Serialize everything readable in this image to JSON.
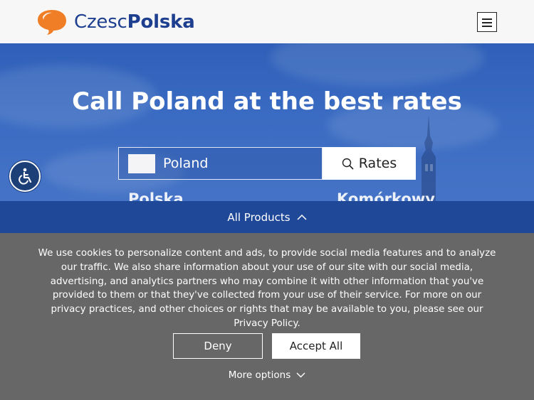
{
  "header": {
    "logo_text_light": "Czesc",
    "logo_text_bold": "Polska",
    "logo_icon": "speech-bubble-icon",
    "menu_icon": "hamburger-menu-icon"
  },
  "hero": {
    "title": "Call Poland at the best rates",
    "country_value": "Poland",
    "rates_label": "Rates",
    "search_icon": "search-icon",
    "peek_left": "Polska",
    "peek_right": "Komórkowy"
  },
  "accessibility": {
    "icon": "wheelchair-accessibility-icon"
  },
  "products_bar": {
    "label": "All Products",
    "icon": "chevron-up-icon"
  },
  "cookie_banner": {
    "text": "We use cookies to personalize content and ads, to provide social media features and to analyze our traffic. We also share information about your use of our site with our social media, advertising, and analytics partners who may combine it with other information that you've provided to them or that they've collected from your use of their service. For more on our privacy practices, and other choices or rights that may be available to you, please see our Privacy Policy.",
    "deny_label": "Deny",
    "accept_label": "Accept All",
    "more_label": "More options",
    "more_icon": "chevron-down-icon"
  },
  "colors": {
    "brand_blue": "#1e3f8f",
    "logo_orange": "#f07e26",
    "hero_blue": "#3a6bc2",
    "products_bar": "#204898",
    "cookie_bg": "#676767"
  }
}
